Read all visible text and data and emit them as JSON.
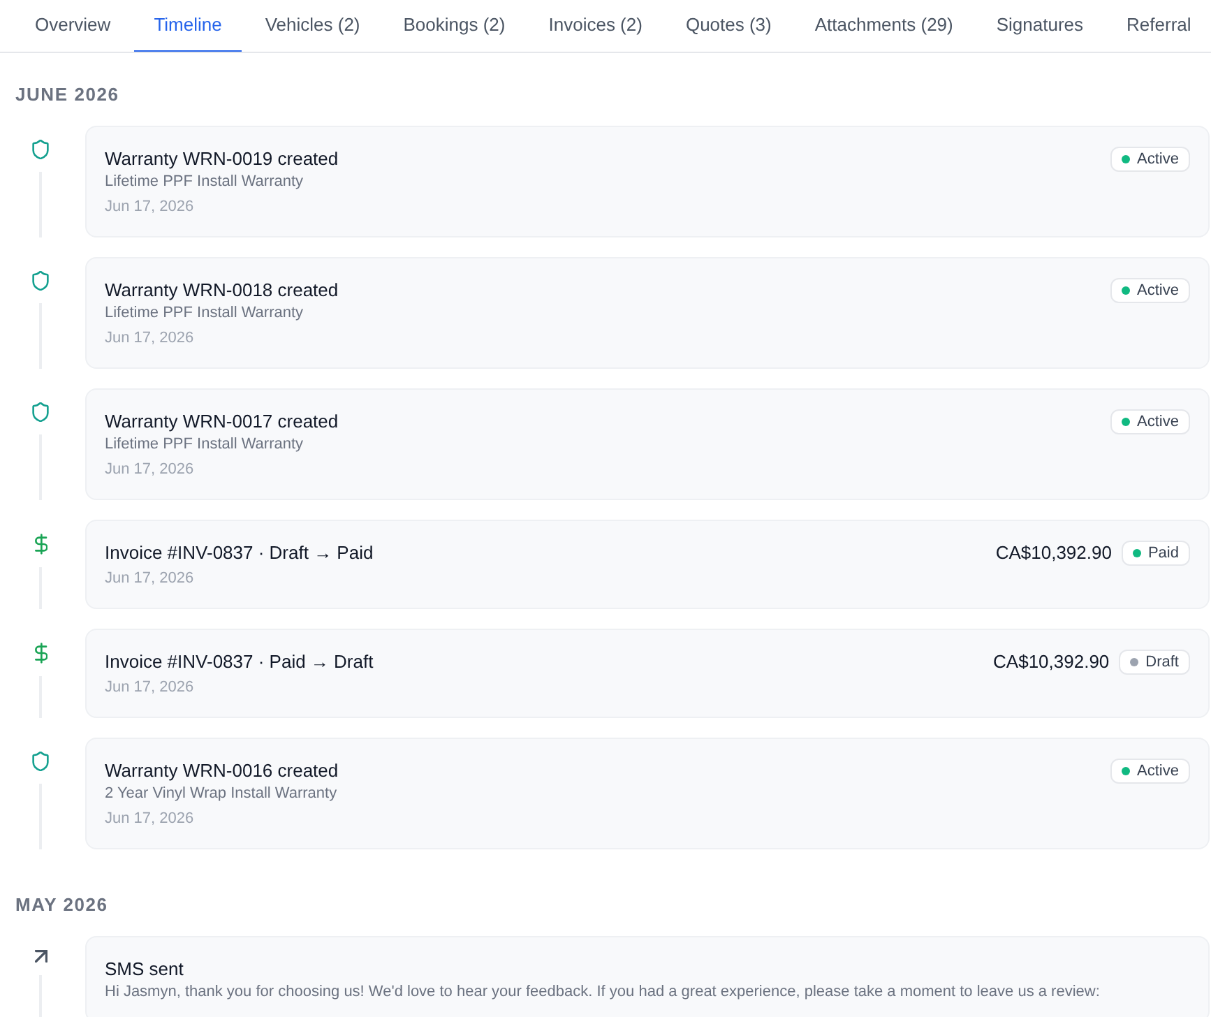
{
  "tabs": [
    {
      "label": "Overview",
      "selected": false
    },
    {
      "label": "Timeline",
      "selected": true
    },
    {
      "label": "Vehicles (2)",
      "selected": false
    },
    {
      "label": "Bookings (2)",
      "selected": false
    },
    {
      "label": "Invoices (2)",
      "selected": false
    },
    {
      "label": "Quotes (3)",
      "selected": false
    },
    {
      "label": "Attachments (29)",
      "selected": false
    },
    {
      "label": "Signatures",
      "selected": false
    },
    {
      "label": "Referral",
      "selected": false
    }
  ],
  "timeline": [
    {
      "heading": "JUNE 2026",
      "events": [
        {
          "kind": "warranty",
          "title": "Warranty WRN-0019 created",
          "subtitle": "Lifetime PPF Install Warranty",
          "date": "Jun 17, 2026",
          "status": {
            "label": "Active",
            "color": "#10b981"
          }
        },
        {
          "kind": "warranty",
          "title": "Warranty WRN-0018 created",
          "subtitle": "Lifetime PPF Install Warranty",
          "date": "Jun 17, 2026",
          "status": {
            "label": "Active",
            "color": "#10b981"
          }
        },
        {
          "kind": "warranty",
          "title": "Warranty WRN-0017 created",
          "subtitle": "Lifetime PPF Install Warranty",
          "date": "Jun 17, 2026",
          "status": {
            "label": "Active",
            "color": "#10b981"
          }
        },
        {
          "kind": "invoice",
          "title": "Invoice #INV-0837 · Draft → Paid",
          "date": "Jun 17, 2026",
          "amount": "CA$10,392.90",
          "status": {
            "label": "Paid",
            "color": "#10b981"
          }
        },
        {
          "kind": "invoice",
          "title": "Invoice #INV-0837 · Paid → Draft",
          "date": "Jun 17, 2026",
          "amount": "CA$10,392.90",
          "status": {
            "label": "Draft",
            "color": "#9ca3af"
          }
        },
        {
          "kind": "warranty",
          "title": "Warranty WRN-0016 created",
          "subtitle": "2 Year Vinyl Wrap Install Warranty",
          "date": "Jun 17, 2026",
          "status": {
            "label": "Active",
            "color": "#10b981"
          }
        }
      ]
    },
    {
      "heading": "MAY 2026",
      "events": [
        {
          "kind": "sms",
          "title": "SMS sent",
          "subtitle": "Hi Jasmyn, thank you for choosing us! We'd love to hear your feedback. If you had a great experience, please take a moment to leave us a review:"
        }
      ]
    }
  ]
}
